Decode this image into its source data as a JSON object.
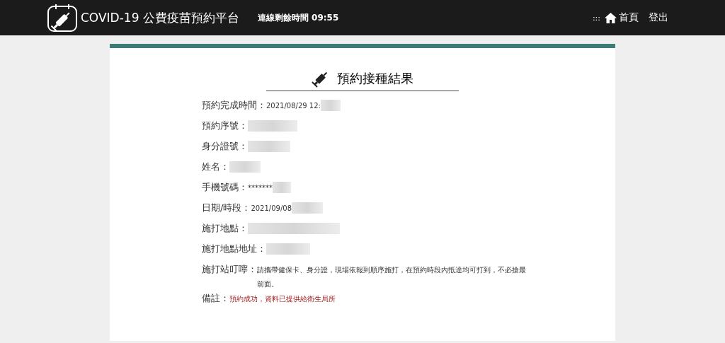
{
  "header": {
    "title": "COVID-19 公費疫苗預約平台",
    "session": "連線剩餘時間 09:55",
    "menu_glyph": ":::",
    "nav": [
      {
        "label": "首頁",
        "kind": "home"
      },
      {
        "label": "登出",
        "kind": "plain"
      }
    ]
  },
  "result": {
    "title": "預約接種結果",
    "rows": [
      {
        "label": "預約完成時間：",
        "value": "2021/08/29 12:",
        "redacted": true,
        "kind": "plain"
      },
      {
        "label": "預約序號：",
        "redacted": true,
        "kind": "plain"
      },
      {
        "label": "身分證號：",
        "redacted": true,
        "kind": "plain"
      },
      {
        "label": "姓名：",
        "redacted": true,
        "kind": "plain"
      },
      {
        "label": "手機號碼：",
        "value": "*******",
        "redacted": true,
        "kind": "plain"
      },
      {
        "label": "日期/時段：",
        "value": "2021/09/08",
        "redacted": true,
        "kind": "plain"
      },
      {
        "label": "施打地點：",
        "redacted": true,
        "kind": "plain"
      },
      {
        "label": "施打地點地址：",
        "redacted": true,
        "kind": "plain"
      },
      {
        "label": "施打站叮嚀：",
        "value": "請攜帶健保卡、身分證，現場依報到順序施打，在預約時段內抵達均可打到，不必搶最前面。",
        "kind": "plain"
      },
      {
        "label": "備註：",
        "value": "預約成功，資料已提供給衛生局所",
        "kind": "alert"
      }
    ]
  }
}
